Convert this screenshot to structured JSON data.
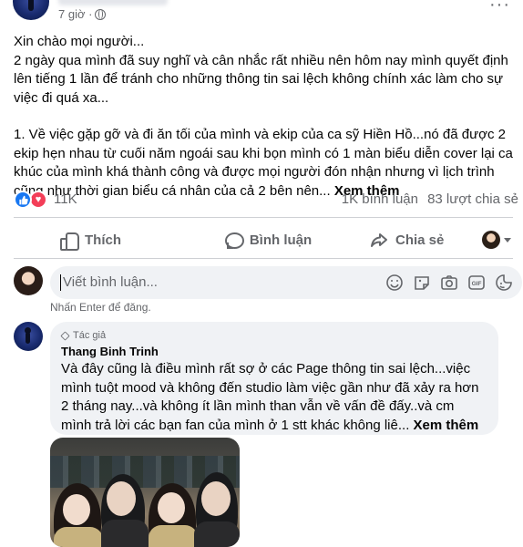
{
  "post": {
    "time": "7 giờ ·",
    "more_label": "···",
    "paragraphs": [
      "Xin chào mọi người...",
      "2 ngày qua mình đã suy nghĩ và cân nhắc rất nhiều nên hôm nay mình quyết định lên tiếng 1 lần để tránh cho những thông tin sai lệch không chính xác làm cho sự việc đi quá xa...",
      "1. Về việc gặp gỡ và đi ăn tối của mình và ekip của ca sỹ Hiền Hồ...nó đã được 2 ekip hẹn nhau từ cuối năm ngoái sau khi bọn mình có 1 màn biểu diễn cover lại ca khúc của mình khá thành công và được mọi người đón nhận nhưng vì lịch trình cũng như thời gian biểu cá nhân của cả 2 bên nên..."
    ],
    "see_more": "Xem thêm"
  },
  "stats": {
    "reactions": "11K",
    "comments": "1K bình luận",
    "shares": "83 lượt chia sẻ"
  },
  "actions": {
    "like": "Thích",
    "comment": "Bình luận",
    "share": "Chia sẻ"
  },
  "composer": {
    "placeholder": "Viết bình luận...",
    "hint": "Nhấn Enter để đăng."
  },
  "comment": {
    "badge": "Tác giả",
    "author": "Thang Binh Trinh",
    "text": "Và đây cũng là điều mình rất sợ ở các Page thông tin sai lệch...việc mình tuột mood và không đến studio làm việc gần như đã xảy ra hơn 2 tháng nay...và không ít lần mình than vẫn về vấn đề đấy..và cm mình trả lời các bạn fan của mình ở 1 stt khác không liê...",
    "see_more": "Xem thêm"
  },
  "colors": {
    "like_blue": "#1877f2",
    "love_red": "#f33e58",
    "muted_text": "#65676b",
    "bubble_bg": "#f0f2f5"
  },
  "icons": [
    "globe-icon",
    "more-icon",
    "like-reaction-icon",
    "love-reaction-icon",
    "thumb-up-icon",
    "comment-icon",
    "share-icon",
    "smiley-icon",
    "sticker-icon",
    "camera-icon",
    "gif-icon",
    "emoji-sticker-icon",
    "pencil-icon"
  ]
}
